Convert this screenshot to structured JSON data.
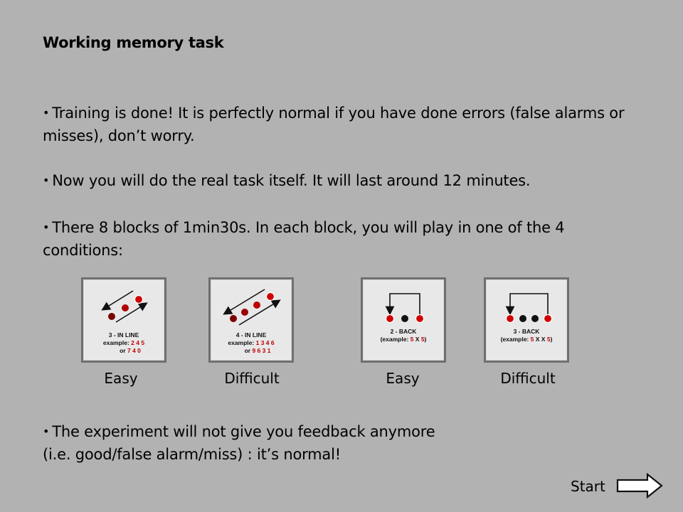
{
  "title": "Working memory task",
  "bullets": [
    {
      "symbol": "•",
      "text": "Training is done! It is perfectly normal if you have done errors (false alarms or misses), don’t worry."
    },
    {
      "symbol": "•",
      "text": "Now you will do the real task itself. It will last around 12 minutes."
    },
    {
      "symbol": "•",
      "text": "There 8 blocks of 1min30s. In each block, you will play in one of the 4 conditions:"
    },
    {
      "symbol": "•",
      "line1": "The experiment will not give you feedback anymore",
      "line2": "(i.e. good/false alarm/miss) : it’s normal!"
    }
  ],
  "conditions": [
    {
      "label": "3 - IN LINE",
      "example_prefix": "example:",
      "example_1": "2 4 5",
      "example_or": "or",
      "example_2": "7 4 0",
      "caption": "Easy"
    },
    {
      "label": "4 - IN LINE",
      "example_prefix": "example:",
      "example_1": "1 3 4 6",
      "example_or": "or",
      "example_2": "9 6 3 1",
      "caption": "Difficult"
    },
    {
      "label": "2 - BACK",
      "example_open": "(example:",
      "example_a": "5",
      "example_mid": "X",
      "example_b": "5",
      "example_close": ")",
      "caption": "Easy"
    },
    {
      "label": "3 - BACK",
      "example_open": "(example:",
      "example_a": "5",
      "example_mid": "X X",
      "example_b": "5",
      "example_close": ")",
      "caption": "Difficult"
    }
  ],
  "start": {
    "label": "Start",
    "icon": "right-arrow-icon"
  },
  "colors": {
    "background": "#b2b2b2",
    "accent_red": "#c00000",
    "dark_red": "#7a0000",
    "card_border": "#6f6f6f"
  }
}
